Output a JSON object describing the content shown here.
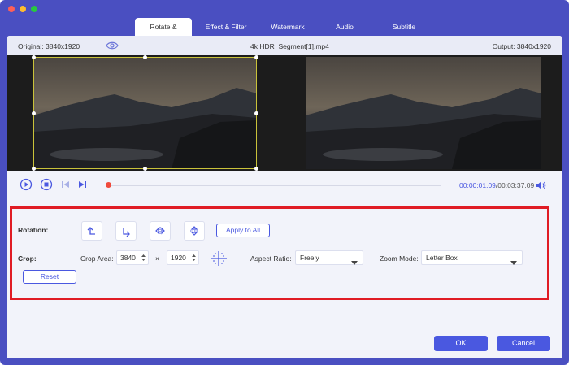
{
  "window": {
    "traffic_colors": [
      "#ff5f57",
      "#febc2e",
      "#28c840"
    ]
  },
  "tabs": [
    {
      "label": "Rotate & Crop",
      "active": true
    },
    {
      "label": "Effect & Filter",
      "active": false
    },
    {
      "label": "Watermark",
      "active": false
    },
    {
      "label": "Audio",
      "active": false
    },
    {
      "label": "Subtitle",
      "active": false
    }
  ],
  "info_bar": {
    "original": "Original: 3840x1920",
    "filename": "4k HDR_Segment[1].mp4",
    "output": "Output: 3840x1920",
    "eye_icon": "eye-icon"
  },
  "playback": {
    "current_time": "00:00:01.09",
    "total_time": "/00:03:37.09",
    "progress": 0.003,
    "icons": [
      "play-icon",
      "stop-icon",
      "prev-icon",
      "next-icon",
      "volume-icon"
    ]
  },
  "rotation": {
    "label": "Rotation:",
    "buttons": [
      "rotate-left-icon",
      "rotate-right-icon",
      "flip-horizontal-icon",
      "flip-vertical-icon"
    ],
    "apply_all_label": "Apply to All"
  },
  "crop": {
    "label": "Crop:",
    "area_label": "Crop Area:",
    "width": "3840",
    "times": "×",
    "height": "1920",
    "center_icon": "crop-center-icon",
    "aspect_label": "Aspect Ratio:",
    "aspect_value": "Freely",
    "zoom_label": "Zoom Mode:",
    "zoom_value": "Letter Box",
    "reset_label": "Reset"
  },
  "footer": {
    "ok_label": "OK",
    "cancel_label": "Cancel"
  },
  "colors": {
    "accent": "#4a58e0",
    "frame": "#4a4fc1",
    "highlight": "#e01b24",
    "crop_border": "#c9c23a"
  }
}
